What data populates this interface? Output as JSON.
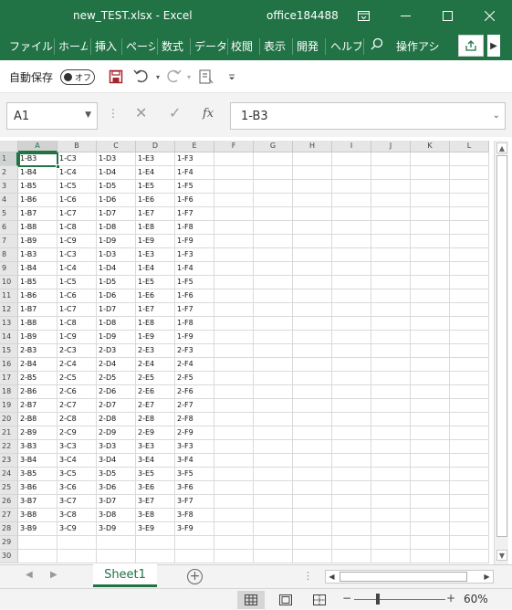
{
  "window": {
    "title": "new_TEST.xlsx  -  Excel",
    "account": "office184488",
    "buttons": [
      "restore-ribbon",
      "minimize",
      "maximize",
      "close"
    ]
  },
  "ribbon": {
    "tabs": [
      "ファイル",
      "ホーム",
      "挿入",
      "ページ",
      "数式",
      "データ",
      "校閲",
      "表示",
      "開発",
      "ヘルプ"
    ],
    "search_label": "操作アシ"
  },
  "qat": {
    "autosave_label": "自動保存",
    "autosave_state": "オフ"
  },
  "formula_bar": {
    "name_box": "A1",
    "formula": "1-B3",
    "fx_label": "fx"
  },
  "grid": {
    "columns": [
      "A",
      "B",
      "C",
      "D",
      "E",
      "F",
      "G",
      "H",
      "I",
      "J",
      "K",
      "L"
    ],
    "row_numbers": [
      "1",
      "2",
      "3",
      "4",
      "5",
      "6",
      "7",
      "8",
      "9",
      "10",
      "11",
      "12",
      "13",
      "14",
      "15",
      "16",
      "17",
      "18",
      "19",
      "20",
      "21",
      "22",
      "23",
      "24",
      "25",
      "26",
      "27",
      "28",
      "29",
      "30"
    ],
    "rows": [
      [
        "1-B3",
        "1-C3",
        "1-D3",
        "1-E3",
        "1-F3"
      ],
      [
        "1-B4",
        "1-C4",
        "1-D4",
        "1-E4",
        "1-F4"
      ],
      [
        "1-B5",
        "1-C5",
        "1-D5",
        "1-E5",
        "1-F5"
      ],
      [
        "1-B6",
        "1-C6",
        "1-D6",
        "1-E6",
        "1-F6"
      ],
      [
        "1-B7",
        "1-C7",
        "1-D7",
        "1-E7",
        "1-F7"
      ],
      [
        "1-B8",
        "1-C8",
        "1-D8",
        "1-E8",
        "1-F8"
      ],
      [
        "1-B9",
        "1-C9",
        "1-D9",
        "1-E9",
        "1-F9"
      ],
      [
        "1-B3",
        "1-C3",
        "1-D3",
        "1-E3",
        "1-F3"
      ],
      [
        "1-B4",
        "1-C4",
        "1-D4",
        "1-E4",
        "1-F4"
      ],
      [
        "1-B5",
        "1-C5",
        "1-D5",
        "1-E5",
        "1-F5"
      ],
      [
        "1-B6",
        "1-C6",
        "1-D6",
        "1-E6",
        "1-F6"
      ],
      [
        "1-B7",
        "1-C7",
        "1-D7",
        "1-E7",
        "1-F7"
      ],
      [
        "1-B8",
        "1-C8",
        "1-D8",
        "1-E8",
        "1-F8"
      ],
      [
        "1-B9",
        "1-C9",
        "1-D9",
        "1-E9",
        "1-F9"
      ],
      [
        "2-B3",
        "2-C3",
        "2-D3",
        "2-E3",
        "2-F3"
      ],
      [
        "2-B4",
        "2-C4",
        "2-D4",
        "2-E4",
        "2-F4"
      ],
      [
        "2-B5",
        "2-C5",
        "2-D5",
        "2-E5",
        "2-F5"
      ],
      [
        "2-B6",
        "2-C6",
        "2-D6",
        "2-E6",
        "2-F6"
      ],
      [
        "2-B7",
        "2-C7",
        "2-D7",
        "2-E7",
        "2-F7"
      ],
      [
        "2-B8",
        "2-C8",
        "2-D8",
        "2-E8",
        "2-F8"
      ],
      [
        "2-B9",
        "2-C9",
        "2-D9",
        "2-E9",
        "2-F9"
      ],
      [
        "3-B3",
        "3-C3",
        "3-D3",
        "3-E3",
        "3-F3"
      ],
      [
        "3-B4",
        "3-C4",
        "3-D4",
        "3-E4",
        "3-F4"
      ],
      [
        "3-B5",
        "3-C5",
        "3-D5",
        "3-E5",
        "3-F5"
      ],
      [
        "3-B6",
        "3-C6",
        "3-D6",
        "3-E6",
        "3-F6"
      ],
      [
        "3-B7",
        "3-C7",
        "3-D7",
        "3-E7",
        "3-F7"
      ],
      [
        "3-B8",
        "3-C8",
        "3-D8",
        "3-E8",
        "3-F8"
      ],
      [
        "3-B9",
        "3-C9",
        "3-D9",
        "3-E9",
        "3-F9"
      ],
      [
        "",
        "",
        "",
        "",
        ""
      ],
      [
        "",
        "",
        "",
        "",
        ""
      ]
    ]
  },
  "sheets": {
    "tabs": [
      "Sheet1"
    ],
    "active": "Sheet1"
  },
  "status": {
    "zoom": "60%",
    "zoom_out": "−",
    "zoom_in": "+"
  },
  "colors": {
    "accent": "#217346"
  }
}
